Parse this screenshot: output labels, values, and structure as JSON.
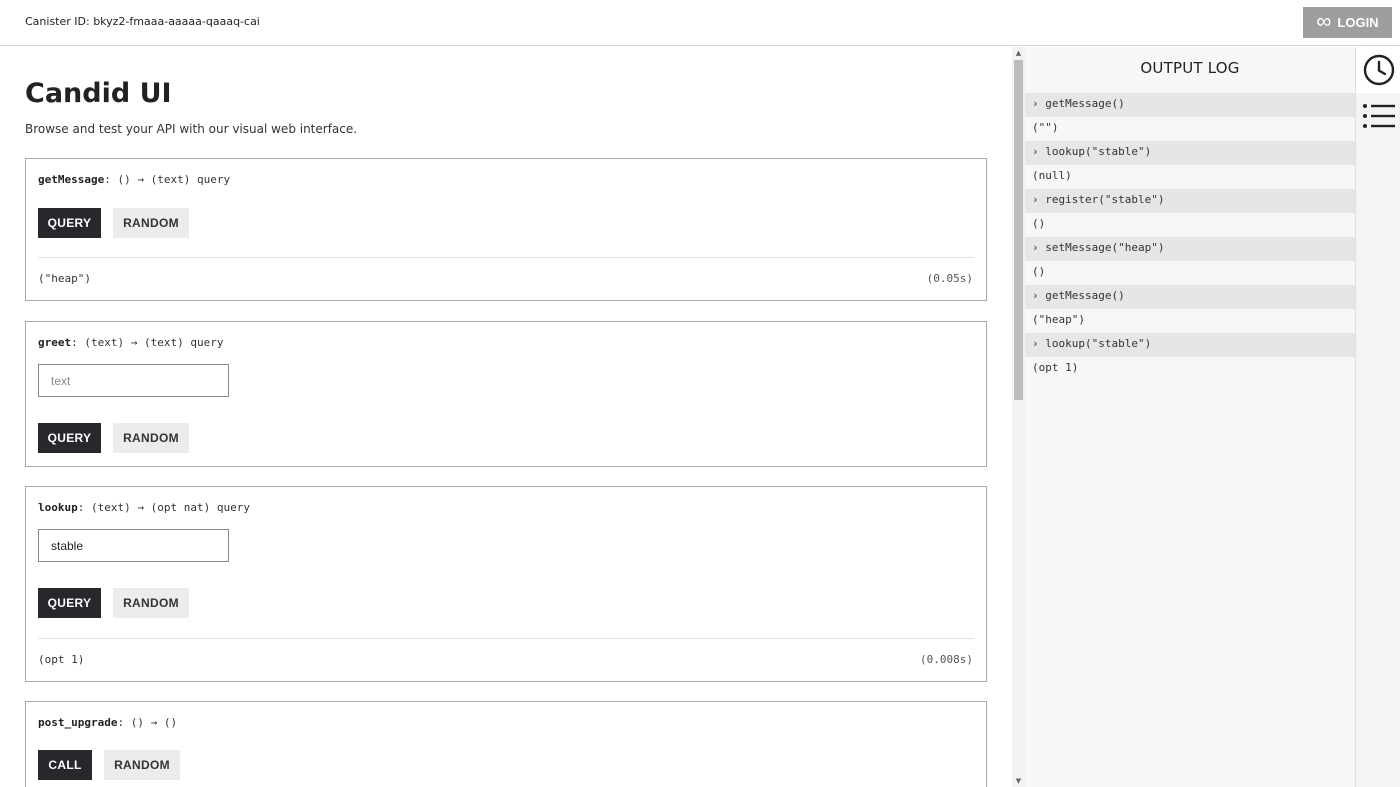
{
  "header": {
    "canister_label": "Canister ID: bkyz2-fmaaa-aaaaa-qaaaq-cai",
    "login_label": "LOGIN"
  },
  "page": {
    "title": "Candid UI",
    "subtitle": "Browse and test your API with our visual web interface."
  },
  "methods": [
    {
      "name": "getMessage",
      "signature": ": () → (text) query",
      "primary_label": "QUERY",
      "random_label": "RANDOM",
      "result": "(\"heap\")",
      "timing": "(0.05s)"
    },
    {
      "name": "greet",
      "signature": ": (text) → (text) query",
      "input_placeholder": "text",
      "input_value": "",
      "primary_label": "QUERY",
      "random_label": "RANDOM"
    },
    {
      "name": "lookup",
      "signature": ": (text) → (opt nat) query",
      "input_placeholder": "text",
      "input_value": "stable",
      "primary_label": "QUERY",
      "random_label": "RANDOM",
      "result": "(opt 1)",
      "timing": "(0.008s)"
    },
    {
      "name": "post_upgrade",
      "signature": ": () → ()",
      "primary_label": "CALL",
      "random_label": "RANDOM"
    }
  ],
  "output_log": {
    "title": "OUTPUT LOG",
    "entries": [
      {
        "kind": "call",
        "text": "› getMessage()"
      },
      {
        "kind": "ret",
        "text": "(\"\")"
      },
      {
        "kind": "call",
        "text": "› lookup(\"stable\")"
      },
      {
        "kind": "ret",
        "text": "(null)"
      },
      {
        "kind": "call",
        "text": "› register(\"stable\")"
      },
      {
        "kind": "ret",
        "text": "()"
      },
      {
        "kind": "call",
        "text": "› setMessage(\"heap\")"
      },
      {
        "kind": "ret",
        "text": "()"
      },
      {
        "kind": "call",
        "text": "› getMessage()"
      },
      {
        "kind": "ret",
        "text": "(\"heap\")"
      },
      {
        "kind": "call",
        "text": "› lookup(\"stable\")"
      },
      {
        "kind": "ret",
        "text": "(opt 1)"
      }
    ]
  },
  "icons": {
    "login": "infinity-icon",
    "history": "clock-icon",
    "methods": "list-icon"
  },
  "colors": {
    "primary_button": "#27282c",
    "secondary_button": "#ececec",
    "login_button": "#9e9e9e",
    "log_call_row": "#e6e6e6"
  }
}
